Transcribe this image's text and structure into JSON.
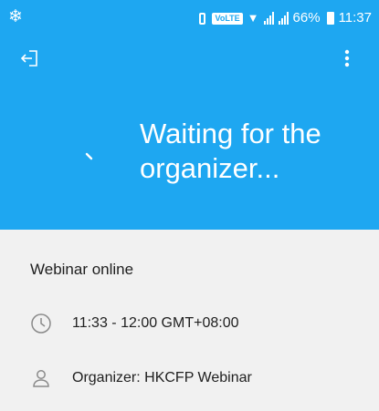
{
  "status_bar": {
    "left_icon": "snowflake-icon",
    "volte": "VoLTE",
    "battery_percent": "66%",
    "time": "11:37"
  },
  "header": {
    "exit_icon": "exit-icon",
    "menu_icon": "more-vert-icon",
    "waiting_text": "Waiting for the organizer...",
    "background_color": "#1ea7f1"
  },
  "meeting": {
    "title": "Webinar online",
    "time_icon": "clock-icon",
    "time": "11:33 - 12:00 GMT+08:00",
    "organizer_icon": "person-icon",
    "organizer": "Organizer: HKCFP Webinar"
  }
}
